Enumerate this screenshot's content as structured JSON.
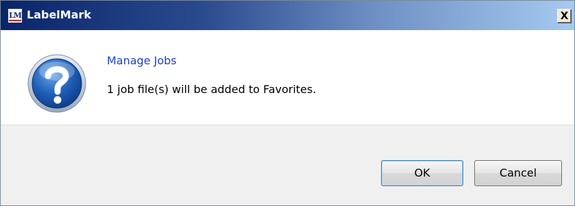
{
  "window": {
    "logo_text": "LM",
    "title": "LabelMark",
    "close_label": "X"
  },
  "dialog": {
    "icon": "question-icon",
    "heading": "Manage Jobs",
    "message": "1 job file(s) will be added to Favorites."
  },
  "buttons": {
    "ok_label": "OK",
    "cancel_label": "Cancel"
  },
  "colors": {
    "title_bar_start": "#0a246a",
    "title_bar_end": "#a6caf0",
    "heading": "#1a3fd0",
    "footer_bg": "#f0f0f0"
  }
}
